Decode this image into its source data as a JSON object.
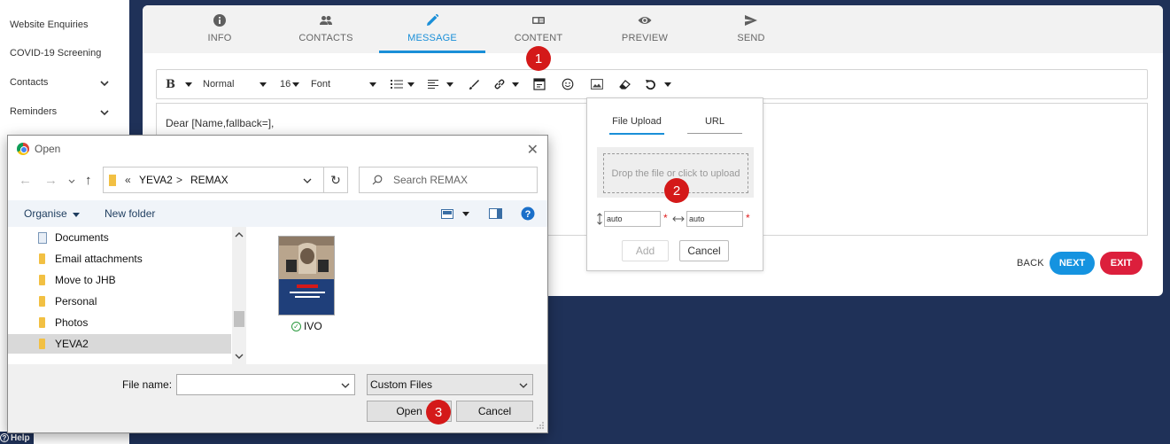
{
  "sidebar": {
    "items": [
      {
        "label": "Website Enquiries",
        "chevron": false
      },
      {
        "label": "COVID-19 Screening",
        "chevron": false
      },
      {
        "label": "Contacts",
        "chevron": true
      },
      {
        "label": "Reminders",
        "chevron": true
      }
    ],
    "help_label": "Help"
  },
  "wizard": {
    "tabs": [
      {
        "label": "INFO",
        "icon": "info-icon"
      },
      {
        "label": "CONTACTS",
        "icon": "people-icon"
      },
      {
        "label": "MESSAGE",
        "icon": "pencil-icon",
        "active": true
      },
      {
        "label": "CONTENT",
        "icon": "content-icon"
      },
      {
        "label": "PREVIEW",
        "icon": "eye-icon"
      },
      {
        "label": "SEND",
        "icon": "send-icon"
      }
    ],
    "accent_color": "#1a8fd8"
  },
  "toolbar": {
    "bold": "B",
    "style": "Normal",
    "size": "16",
    "font": "Font"
  },
  "editor": {
    "body": "Dear [Name,fallback=],"
  },
  "actions": {
    "back": "BACK",
    "next": "NEXT",
    "exit": "EXIT",
    "next_color": "#1593e0",
    "exit_color": "#dc1f3c"
  },
  "image_popover": {
    "tab_upload": "File Upload",
    "tab_url": "URL",
    "dropzone": "Drop the file or click to upload",
    "width_value": "auto",
    "height_value": "auto",
    "required_mark": "*",
    "add": "Add",
    "cancel": "Cancel"
  },
  "badges": [
    "1",
    "2",
    "3"
  ],
  "file_dialog": {
    "title": "Open",
    "path_prefix": "«",
    "path": [
      "YEVA2",
      "REMAX"
    ],
    "path_separator": ">",
    "search_placeholder": "Search REMAX",
    "organise": "Organise",
    "new_folder": "New folder",
    "tree": [
      {
        "label": "Documents",
        "type": "doc"
      },
      {
        "label": "Email attachments",
        "type": "folder"
      },
      {
        "label": "Move to JHB",
        "type": "folder"
      },
      {
        "label": "Personal",
        "type": "folder"
      },
      {
        "label": "Photos",
        "type": "folder"
      },
      {
        "label": "YEVA2",
        "type": "folder",
        "selected": true
      }
    ],
    "file": {
      "name": "IVO"
    },
    "file_name_label": "File name:",
    "file_name_value": "",
    "file_type": "Custom Files",
    "open": "Open",
    "cancel": "Cancel"
  }
}
